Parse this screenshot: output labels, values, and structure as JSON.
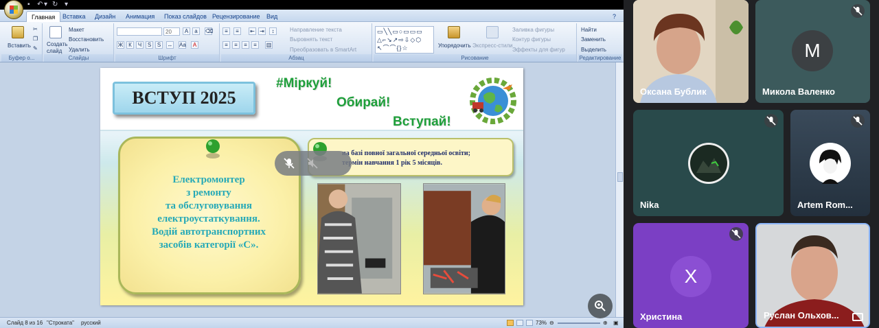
{
  "ppt": {
    "tabs": [
      "Главная",
      "Вставка",
      "Дизайн",
      "Анимация",
      "Показ слайдов",
      "Рецензирование",
      "Вид"
    ],
    "active_tab": "Главная",
    "groups": {
      "clipboard": {
        "label": "Буфер о...",
        "paste": "Вставить"
      },
      "slides": {
        "label": "Слайды",
        "create": "Создать",
        "create2": "слайд",
        "layout": "Макет",
        "reset": "Восстановить",
        "delete": "Удалить"
      },
      "font": {
        "label": "Шрифт",
        "size": "20"
      },
      "paragraph": {
        "label": "Абзац",
        "text_direction": "Направление текста",
        "align_text": "Выровнять текст",
        "smartart": "Преобразовать в SmartArt"
      },
      "drawing": {
        "label": "Рисование",
        "arrange": "Упорядочить",
        "quick_styles": "Экспресс-стили",
        "fill": "Заливка фигуры",
        "outline": "Контур фигуры",
        "effects": "Эффекты для фигур"
      },
      "editing": {
        "label": "Редактирование",
        "find": "Найти",
        "replace": "Заменить",
        "select": "Выделить"
      }
    },
    "status": {
      "slide": "Слайд 8 из 16",
      "theme": "\"Строката\"",
      "lang": "русский",
      "zoom": "73%"
    }
  },
  "slide": {
    "title_box": "ВСТУП 2025",
    "slogan1": "#Міркуй!",
    "slogan2": "Обирай!",
    "slogan3": "Вступай!",
    "main_text": [
      "Електромонтер",
      "з ремонту",
      "та обслуговування",
      "електроустаткування.",
      "Водій  автотранспортних",
      "засобів категорії «С»."
    ],
    "info_line1": "на базі повної загальної середньої освіти;",
    "info_line2": "термін навчання 1 рік 5  місяців."
  },
  "meet": {
    "participants": [
      {
        "name": "Оксана Бублик",
        "muted": false,
        "video": true
      },
      {
        "name": "Микола Валенко",
        "muted": true,
        "initial": "М",
        "avatar_color": "#3c4043"
      },
      {
        "name": "Nika",
        "muted": true,
        "video": false
      },
      {
        "name": "Artem Rom...",
        "muted": true,
        "video": false
      },
      {
        "name": "Христина",
        "muted": true,
        "initial": "Х",
        "avatar_color": "#7b3fc4"
      },
      {
        "name": "Руслан Ольхов...",
        "muted": false,
        "video": true
      }
    ]
  }
}
